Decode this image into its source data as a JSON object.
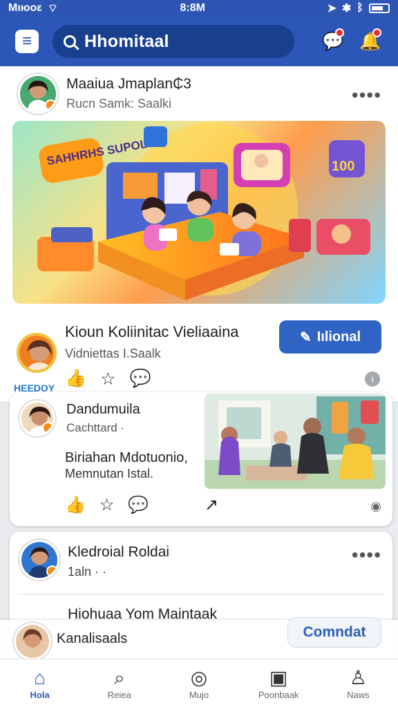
{
  "status": {
    "carrier": "Mıюoε",
    "time": "8:8M"
  },
  "header": {
    "search_value": "Hhomitaal"
  },
  "post1": {
    "name": "Maaiua Jmaplan₵3",
    "meta": "Rucn Samk: Saalki",
    "more": "••••"
  },
  "hero": {
    "badge_text": "SAHHRHS SUPOLKA",
    "score_text": "100"
  },
  "share": {
    "title": "Kioun Koliinitac Vieliaaina",
    "meta": "Vidniettas I.Saalk",
    "button": "Iılional",
    "brand": "HEEDOY"
  },
  "card2": {
    "name": "Dandumuila",
    "meta": "Cachttard ·",
    "body": "Biriahan Mdotuonio,",
    "footnote": "Memnutan Istal."
  },
  "card3": {
    "name": "Kledroial Roldai",
    "meta": "1aln ·  ·",
    "next_name": "Hiohuaa Yom Maintaak"
  },
  "comment": {
    "placeholder": "Kanalisaals",
    "button": "Comndat"
  },
  "nav": {
    "items": [
      {
        "label": "Hola"
      },
      {
        "label": "Reiea"
      },
      {
        "label": "Mujo"
      },
      {
        "label": "Poonbaak"
      },
      {
        "label": "Naws"
      }
    ]
  }
}
